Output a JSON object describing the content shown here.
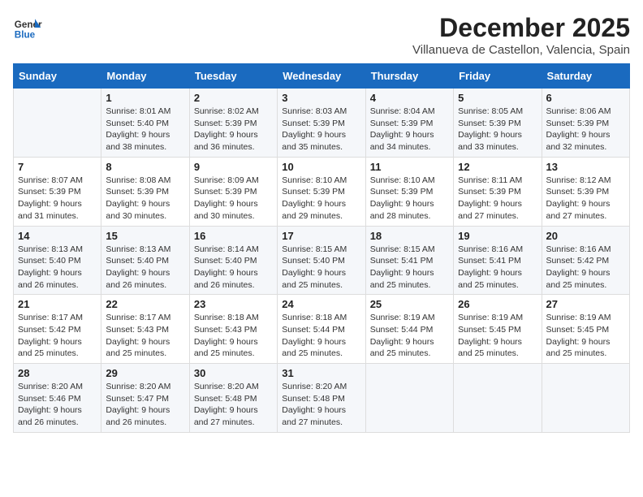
{
  "header": {
    "logo_general": "General",
    "logo_blue": "Blue",
    "month_year": "December 2025",
    "location": "Villanueva de Castellon, Valencia, Spain"
  },
  "weekdays": [
    "Sunday",
    "Monday",
    "Tuesday",
    "Wednesday",
    "Thursday",
    "Friday",
    "Saturday"
  ],
  "weeks": [
    [
      {
        "day": "",
        "sunrise": "",
        "sunset": "",
        "daylight": ""
      },
      {
        "day": "1",
        "sunrise": "Sunrise: 8:01 AM",
        "sunset": "Sunset: 5:40 PM",
        "daylight": "Daylight: 9 hours and 38 minutes."
      },
      {
        "day": "2",
        "sunrise": "Sunrise: 8:02 AM",
        "sunset": "Sunset: 5:39 PM",
        "daylight": "Daylight: 9 hours and 36 minutes."
      },
      {
        "day": "3",
        "sunrise": "Sunrise: 8:03 AM",
        "sunset": "Sunset: 5:39 PM",
        "daylight": "Daylight: 9 hours and 35 minutes."
      },
      {
        "day": "4",
        "sunrise": "Sunrise: 8:04 AM",
        "sunset": "Sunset: 5:39 PM",
        "daylight": "Daylight: 9 hours and 34 minutes."
      },
      {
        "day": "5",
        "sunrise": "Sunrise: 8:05 AM",
        "sunset": "Sunset: 5:39 PM",
        "daylight": "Daylight: 9 hours and 33 minutes."
      },
      {
        "day": "6",
        "sunrise": "Sunrise: 8:06 AM",
        "sunset": "Sunset: 5:39 PM",
        "daylight": "Daylight: 9 hours and 32 minutes."
      }
    ],
    [
      {
        "day": "7",
        "sunrise": "Sunrise: 8:07 AM",
        "sunset": "Sunset: 5:39 PM",
        "daylight": "Daylight: 9 hours and 31 minutes."
      },
      {
        "day": "8",
        "sunrise": "Sunrise: 8:08 AM",
        "sunset": "Sunset: 5:39 PM",
        "daylight": "Daylight: 9 hours and 30 minutes."
      },
      {
        "day": "9",
        "sunrise": "Sunrise: 8:09 AM",
        "sunset": "Sunset: 5:39 PM",
        "daylight": "Daylight: 9 hours and 30 minutes."
      },
      {
        "day": "10",
        "sunrise": "Sunrise: 8:10 AM",
        "sunset": "Sunset: 5:39 PM",
        "daylight": "Daylight: 9 hours and 29 minutes."
      },
      {
        "day": "11",
        "sunrise": "Sunrise: 8:10 AM",
        "sunset": "Sunset: 5:39 PM",
        "daylight": "Daylight: 9 hours and 28 minutes."
      },
      {
        "day": "12",
        "sunrise": "Sunrise: 8:11 AM",
        "sunset": "Sunset: 5:39 PM",
        "daylight": "Daylight: 9 hours and 27 minutes."
      },
      {
        "day": "13",
        "sunrise": "Sunrise: 8:12 AM",
        "sunset": "Sunset: 5:39 PM",
        "daylight": "Daylight: 9 hours and 27 minutes."
      }
    ],
    [
      {
        "day": "14",
        "sunrise": "Sunrise: 8:13 AM",
        "sunset": "Sunset: 5:40 PM",
        "daylight": "Daylight: 9 hours and 26 minutes."
      },
      {
        "day": "15",
        "sunrise": "Sunrise: 8:13 AM",
        "sunset": "Sunset: 5:40 PM",
        "daylight": "Daylight: 9 hours and 26 minutes."
      },
      {
        "day": "16",
        "sunrise": "Sunrise: 8:14 AM",
        "sunset": "Sunset: 5:40 PM",
        "daylight": "Daylight: 9 hours and 26 minutes."
      },
      {
        "day": "17",
        "sunrise": "Sunrise: 8:15 AM",
        "sunset": "Sunset: 5:40 PM",
        "daylight": "Daylight: 9 hours and 25 minutes."
      },
      {
        "day": "18",
        "sunrise": "Sunrise: 8:15 AM",
        "sunset": "Sunset: 5:41 PM",
        "daylight": "Daylight: 9 hours and 25 minutes."
      },
      {
        "day": "19",
        "sunrise": "Sunrise: 8:16 AM",
        "sunset": "Sunset: 5:41 PM",
        "daylight": "Daylight: 9 hours and 25 minutes."
      },
      {
        "day": "20",
        "sunrise": "Sunrise: 8:16 AM",
        "sunset": "Sunset: 5:42 PM",
        "daylight": "Daylight: 9 hours and 25 minutes."
      }
    ],
    [
      {
        "day": "21",
        "sunrise": "Sunrise: 8:17 AM",
        "sunset": "Sunset: 5:42 PM",
        "daylight": "Daylight: 9 hours and 25 minutes."
      },
      {
        "day": "22",
        "sunrise": "Sunrise: 8:17 AM",
        "sunset": "Sunset: 5:43 PM",
        "daylight": "Daylight: 9 hours and 25 minutes."
      },
      {
        "day": "23",
        "sunrise": "Sunrise: 8:18 AM",
        "sunset": "Sunset: 5:43 PM",
        "daylight": "Daylight: 9 hours and 25 minutes."
      },
      {
        "day": "24",
        "sunrise": "Sunrise: 8:18 AM",
        "sunset": "Sunset: 5:44 PM",
        "daylight": "Daylight: 9 hours and 25 minutes."
      },
      {
        "day": "25",
        "sunrise": "Sunrise: 8:19 AM",
        "sunset": "Sunset: 5:44 PM",
        "daylight": "Daylight: 9 hours and 25 minutes."
      },
      {
        "day": "26",
        "sunrise": "Sunrise: 8:19 AM",
        "sunset": "Sunset: 5:45 PM",
        "daylight": "Daylight: 9 hours and 25 minutes."
      },
      {
        "day": "27",
        "sunrise": "Sunrise: 8:19 AM",
        "sunset": "Sunset: 5:45 PM",
        "daylight": "Daylight: 9 hours and 25 minutes."
      }
    ],
    [
      {
        "day": "28",
        "sunrise": "Sunrise: 8:20 AM",
        "sunset": "Sunset: 5:46 PM",
        "daylight": "Daylight: 9 hours and 26 minutes."
      },
      {
        "day": "29",
        "sunrise": "Sunrise: 8:20 AM",
        "sunset": "Sunset: 5:47 PM",
        "daylight": "Daylight: 9 hours and 26 minutes."
      },
      {
        "day": "30",
        "sunrise": "Sunrise: 8:20 AM",
        "sunset": "Sunset: 5:48 PM",
        "daylight": "Daylight: 9 hours and 27 minutes."
      },
      {
        "day": "31",
        "sunrise": "Sunrise: 8:20 AM",
        "sunset": "Sunset: 5:48 PM",
        "daylight": "Daylight: 9 hours and 27 minutes."
      },
      {
        "day": "",
        "sunrise": "",
        "sunset": "",
        "daylight": ""
      },
      {
        "day": "",
        "sunrise": "",
        "sunset": "",
        "daylight": ""
      },
      {
        "day": "",
        "sunrise": "",
        "sunset": "",
        "daylight": ""
      }
    ]
  ]
}
